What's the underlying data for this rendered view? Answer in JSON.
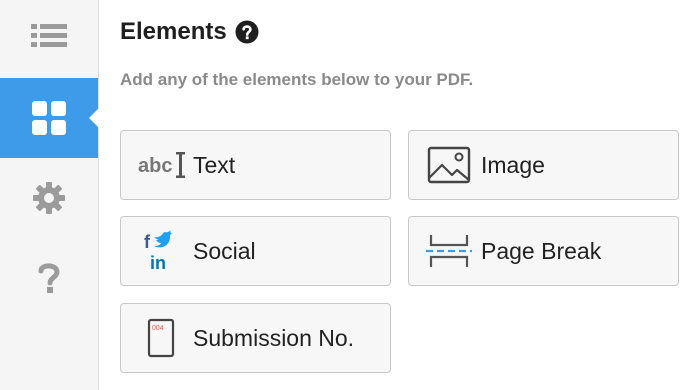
{
  "panel": {
    "title": "Elements",
    "subtitle": "Add any of the elements below to your PDF."
  },
  "elements": [
    {
      "label": "Text",
      "icon": "text-icon",
      "icon_text": "abc"
    },
    {
      "label": "Image",
      "icon": "image-icon"
    },
    {
      "label": "Social",
      "icon": "social-icon"
    },
    {
      "label": "Page Break",
      "icon": "page-break-icon"
    },
    {
      "label": "Submission No.",
      "icon": "submission-number-icon",
      "icon_text": "004"
    }
  ],
  "sidebar": {
    "items": [
      {
        "name": "list-icon",
        "active": false
      },
      {
        "name": "elements-grid-icon",
        "active": true
      },
      {
        "name": "gear-icon",
        "active": false
      },
      {
        "name": "question-icon",
        "active": false
      }
    ]
  },
  "colors": {
    "accent": "#3d9be9",
    "sidebar_icon": "#9b9b9b",
    "twitter": "#1da1f2",
    "facebook": "#3b5998",
    "linkedin": "#0077b5",
    "submission_number": "#e05d44"
  }
}
